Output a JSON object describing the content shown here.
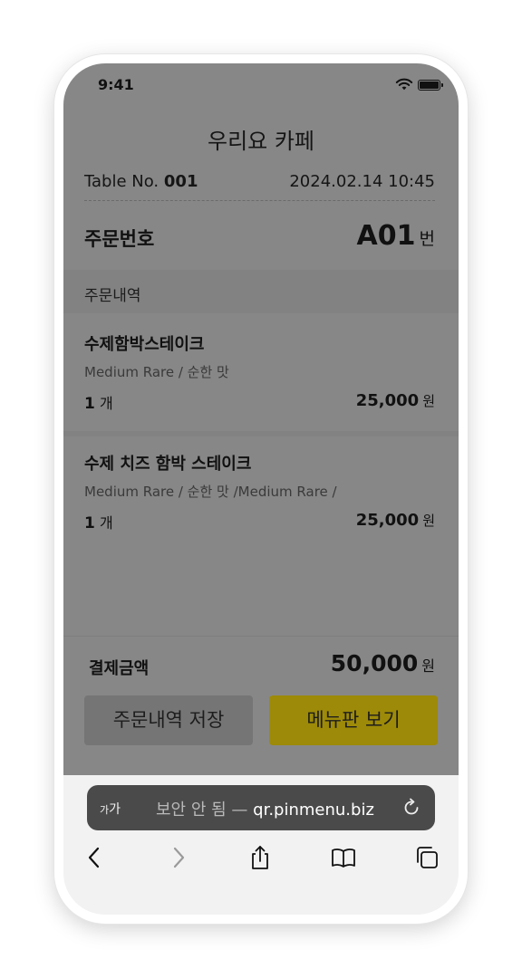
{
  "status_bar": {
    "time": "9:41"
  },
  "cafe_name": "우리요 카페",
  "table": {
    "label": "Table No.",
    "number": "001"
  },
  "datetime": "2024.02.14  10:45",
  "order_number": {
    "label": "주문번호",
    "value": "A01",
    "unit": "번"
  },
  "order_details_label": "주문내역",
  "items": [
    {
      "name": "수제함박스테이크",
      "options": "Medium Rare / 순한 맛",
      "qty": "1",
      "qty_unit": "개",
      "price": "25,000",
      "currency": "원"
    },
    {
      "name": "수제 치즈 함박 스테이크",
      "options": "Medium Rare / 순한 맛 /Medium Rare /",
      "qty": "1",
      "qty_unit": "개",
      "price": "25,000",
      "currency": "원"
    }
  ],
  "total": {
    "label": "결제금액",
    "value": "50,000",
    "currency": "원"
  },
  "buttons": {
    "save": "주문내역 저장",
    "menu": "메뉴판 보기"
  },
  "browser": {
    "text_size_small": "가",
    "text_size_large": "가",
    "security": "보안 안 됨 —",
    "domain": "qr.pinmenu.biz"
  },
  "icons": [
    "wifi-icon",
    "battery-icon",
    "reload-icon",
    "back-icon",
    "forward-icon",
    "share-icon",
    "bookmarks-icon",
    "tabs-icon"
  ],
  "colors": {
    "overlay": "#878787",
    "menu_button": "#9d8a08",
    "url_bar": "#4a4a4a"
  }
}
